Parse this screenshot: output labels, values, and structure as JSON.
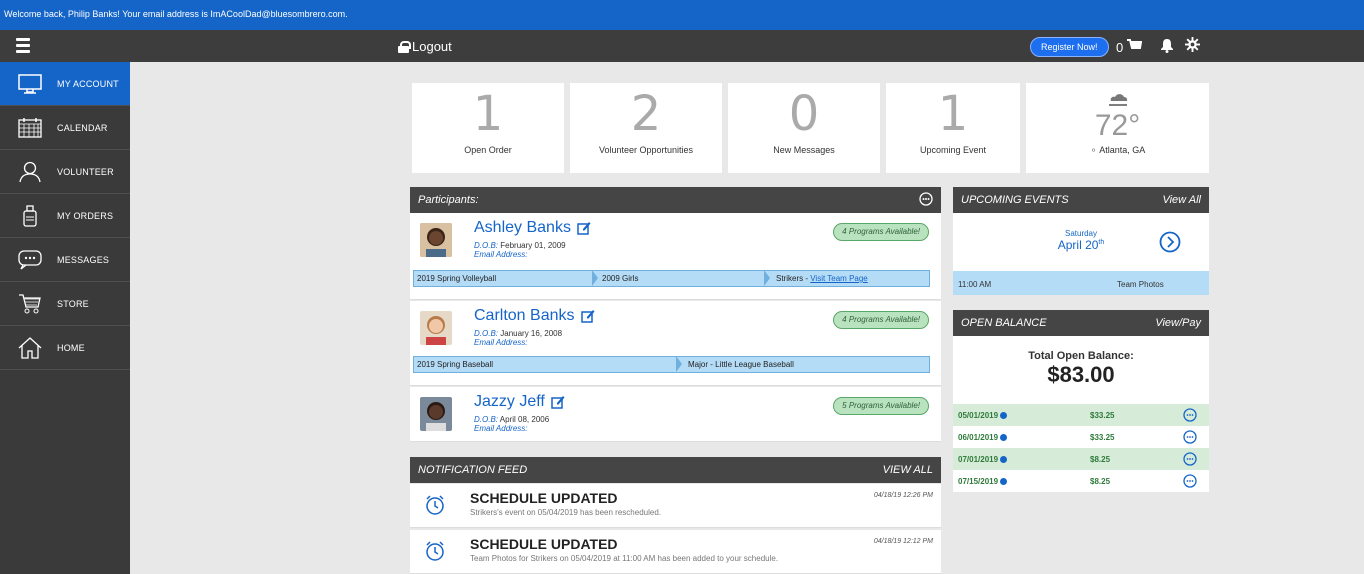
{
  "welcome": "Welcome back, Philip Banks! Your email address is ImACoolDad@bluesombrero.com.",
  "topbar": {
    "logout_label": "Logout",
    "register_label": "Register Now!",
    "cart_count": "0"
  },
  "sidebar": {
    "items": [
      {
        "label": "MY ACCOUNT",
        "icon": "monitor-icon"
      },
      {
        "label": "CALENDAR",
        "icon": "calendar-icon"
      },
      {
        "label": "VOLUNTEER",
        "icon": "person-icon"
      },
      {
        "label": "MY ORDERS",
        "icon": "bottle-icon"
      },
      {
        "label": "MESSAGES",
        "icon": "chat-icon"
      },
      {
        "label": "STORE",
        "icon": "cart-icon"
      },
      {
        "label": "HOME",
        "icon": "house-icon"
      }
    ]
  },
  "stats": [
    {
      "num": "1",
      "label": "Open Order"
    },
    {
      "num": "2",
      "label": "Volunteer Opportunities"
    },
    {
      "num": "0",
      "label": "New Messages"
    },
    {
      "num": "1",
      "label": "Upcoming Event"
    }
  ],
  "weather": {
    "temp": "72",
    "degree": "°",
    "location": "Atlanta, GA"
  },
  "participants": {
    "title": "Participants:",
    "dob_label": "D.O.B:",
    "email_label": "Email Address:",
    "list": [
      {
        "name": "Ashley Banks",
        "dob": "February 01, 2009",
        "programs": "4 Programs Available!",
        "team": [
          "2019 Spring Volleyball",
          "2009 Girls",
          "Strikers - "
        ],
        "team_link": "Visit Team Page"
      },
      {
        "name": "Carlton Banks",
        "dob": "January 16, 2008",
        "programs": "4 Programs Available!",
        "team": [
          "2019 Spring Baseball",
          "Major - Little League Baseball"
        ]
      },
      {
        "name": "Jazzy Jeff",
        "dob": "April 08, 2006",
        "programs": "5 Programs Available!"
      }
    ]
  },
  "notifications": {
    "title": "NOTIFICATION FEED",
    "view_all": "VIEW ALL",
    "items": [
      {
        "title": "SCHEDULE UPDATED",
        "text": "Strikers's event on 05/04/2019 has been rescheduled.",
        "time": "04/18/19 12:26 PM"
      },
      {
        "title": "SCHEDULE UPDATED",
        "text": "Team Photos for Strikers on 05/04/2019 at 11:00 AM has been added to your schedule.",
        "time": "04/18/19 12:12 PM"
      }
    ]
  },
  "events": {
    "title": "UPCOMING EVENTS",
    "view_all": "View All",
    "day": "Saturday",
    "date": "April 20",
    "date_sup": "th",
    "time": "11:00 AM",
    "event": "Team Photos"
  },
  "balance": {
    "title": "OPEN BALANCE",
    "view_pay": "View/Pay",
    "total_label": "Total Open Balance:",
    "total": "$83.00",
    "rows": [
      {
        "date": "05/01/2019",
        "amount": "$33.25"
      },
      {
        "date": "06/01/2019",
        "amount": "$33.25"
      },
      {
        "date": "07/01/2019",
        "amount": "$8.25"
      },
      {
        "date": "07/15/2019",
        "amount": "$8.25"
      }
    ]
  },
  "colors": {
    "brand_blue": "#1565c8",
    "sidebar": "#3a3a3a",
    "badge_green": "#b9e2bf",
    "team_blue": "#b5dcf7"
  }
}
